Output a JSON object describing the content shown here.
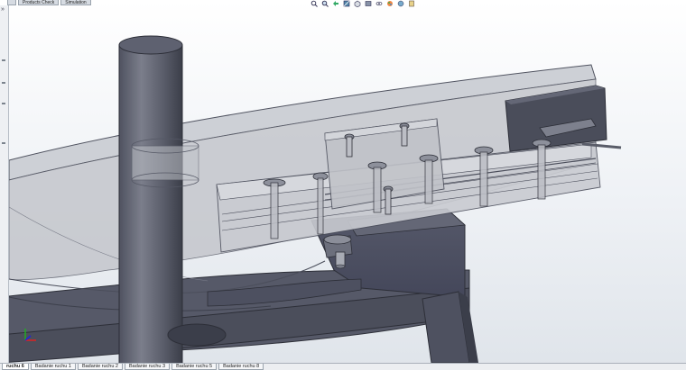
{
  "command_manager": {
    "tabs": [
      "",
      "Products Check",
      "Simulation"
    ]
  },
  "heads_up_toolbar": {
    "buttons": [
      {
        "icon": "zoom-to-fit-icon"
      },
      {
        "icon": "zoom-to-area-icon"
      },
      {
        "icon": "previous-view-icon"
      },
      {
        "icon": "section-view-icon"
      },
      {
        "icon": "view-orientation-icon"
      },
      {
        "icon": "display-style-icon"
      },
      {
        "icon": "hide-show-items-icon"
      },
      {
        "icon": "edit-appearance-icon"
      },
      {
        "icon": "apply-scene-icon"
      },
      {
        "icon": "view-settings-icon"
      }
    ]
  },
  "left_panel": {
    "expand_label": "»"
  },
  "sheet_tabs": [
    {
      "label": "ruchu 6",
      "active": true
    },
    {
      "label": "Badanie ruchu 1",
      "active": false
    },
    {
      "label": "Badanie ruchu 2",
      "active": false
    },
    {
      "label": "Badanie ruchu 3",
      "active": false
    },
    {
      "label": "Badanie ruchu 5",
      "active": false
    },
    {
      "label": "Badanie ruchu 8",
      "active": false
    }
  ],
  "colors": {
    "metal_dark": "#4a4d5a",
    "metal_mid": "#6a6d7a",
    "metal_light": "#9da0ab",
    "plate_transparent": "#c4c6cc",
    "edge": "#2d2f38"
  }
}
